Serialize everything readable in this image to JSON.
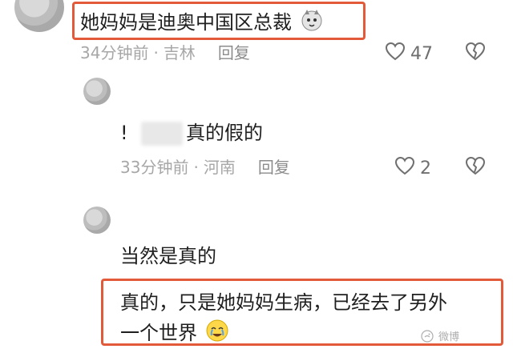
{
  "comments": [
    {
      "text": "她妈妈是迪奥中国区总裁",
      "time": "34分钟前",
      "location": "吉林",
      "reply_label": "回复",
      "likes": "47"
    },
    {
      "text_prefix": "!",
      "text_suffix": "真的假的",
      "time": "33分钟前",
      "location": "河南",
      "reply_label": "回复",
      "likes": "2"
    },
    {
      "text": "当然是真的"
    },
    {
      "text_line1": "真的，只是她妈妈生病，已经去了另外",
      "text_line2": "一个世界"
    }
  ],
  "separator": "·",
  "watermark": "微博",
  "colors": {
    "highlight": "#e35a3b",
    "text": "#1f1f1f",
    "meta": "#a7a7a7"
  },
  "icons": {
    "like": "heart-outline-icon",
    "dislike": "broken-heart-icon",
    "emoji1": "dog-face-emoji-icon",
    "emoji2": "crying-face-emoji-icon"
  }
}
